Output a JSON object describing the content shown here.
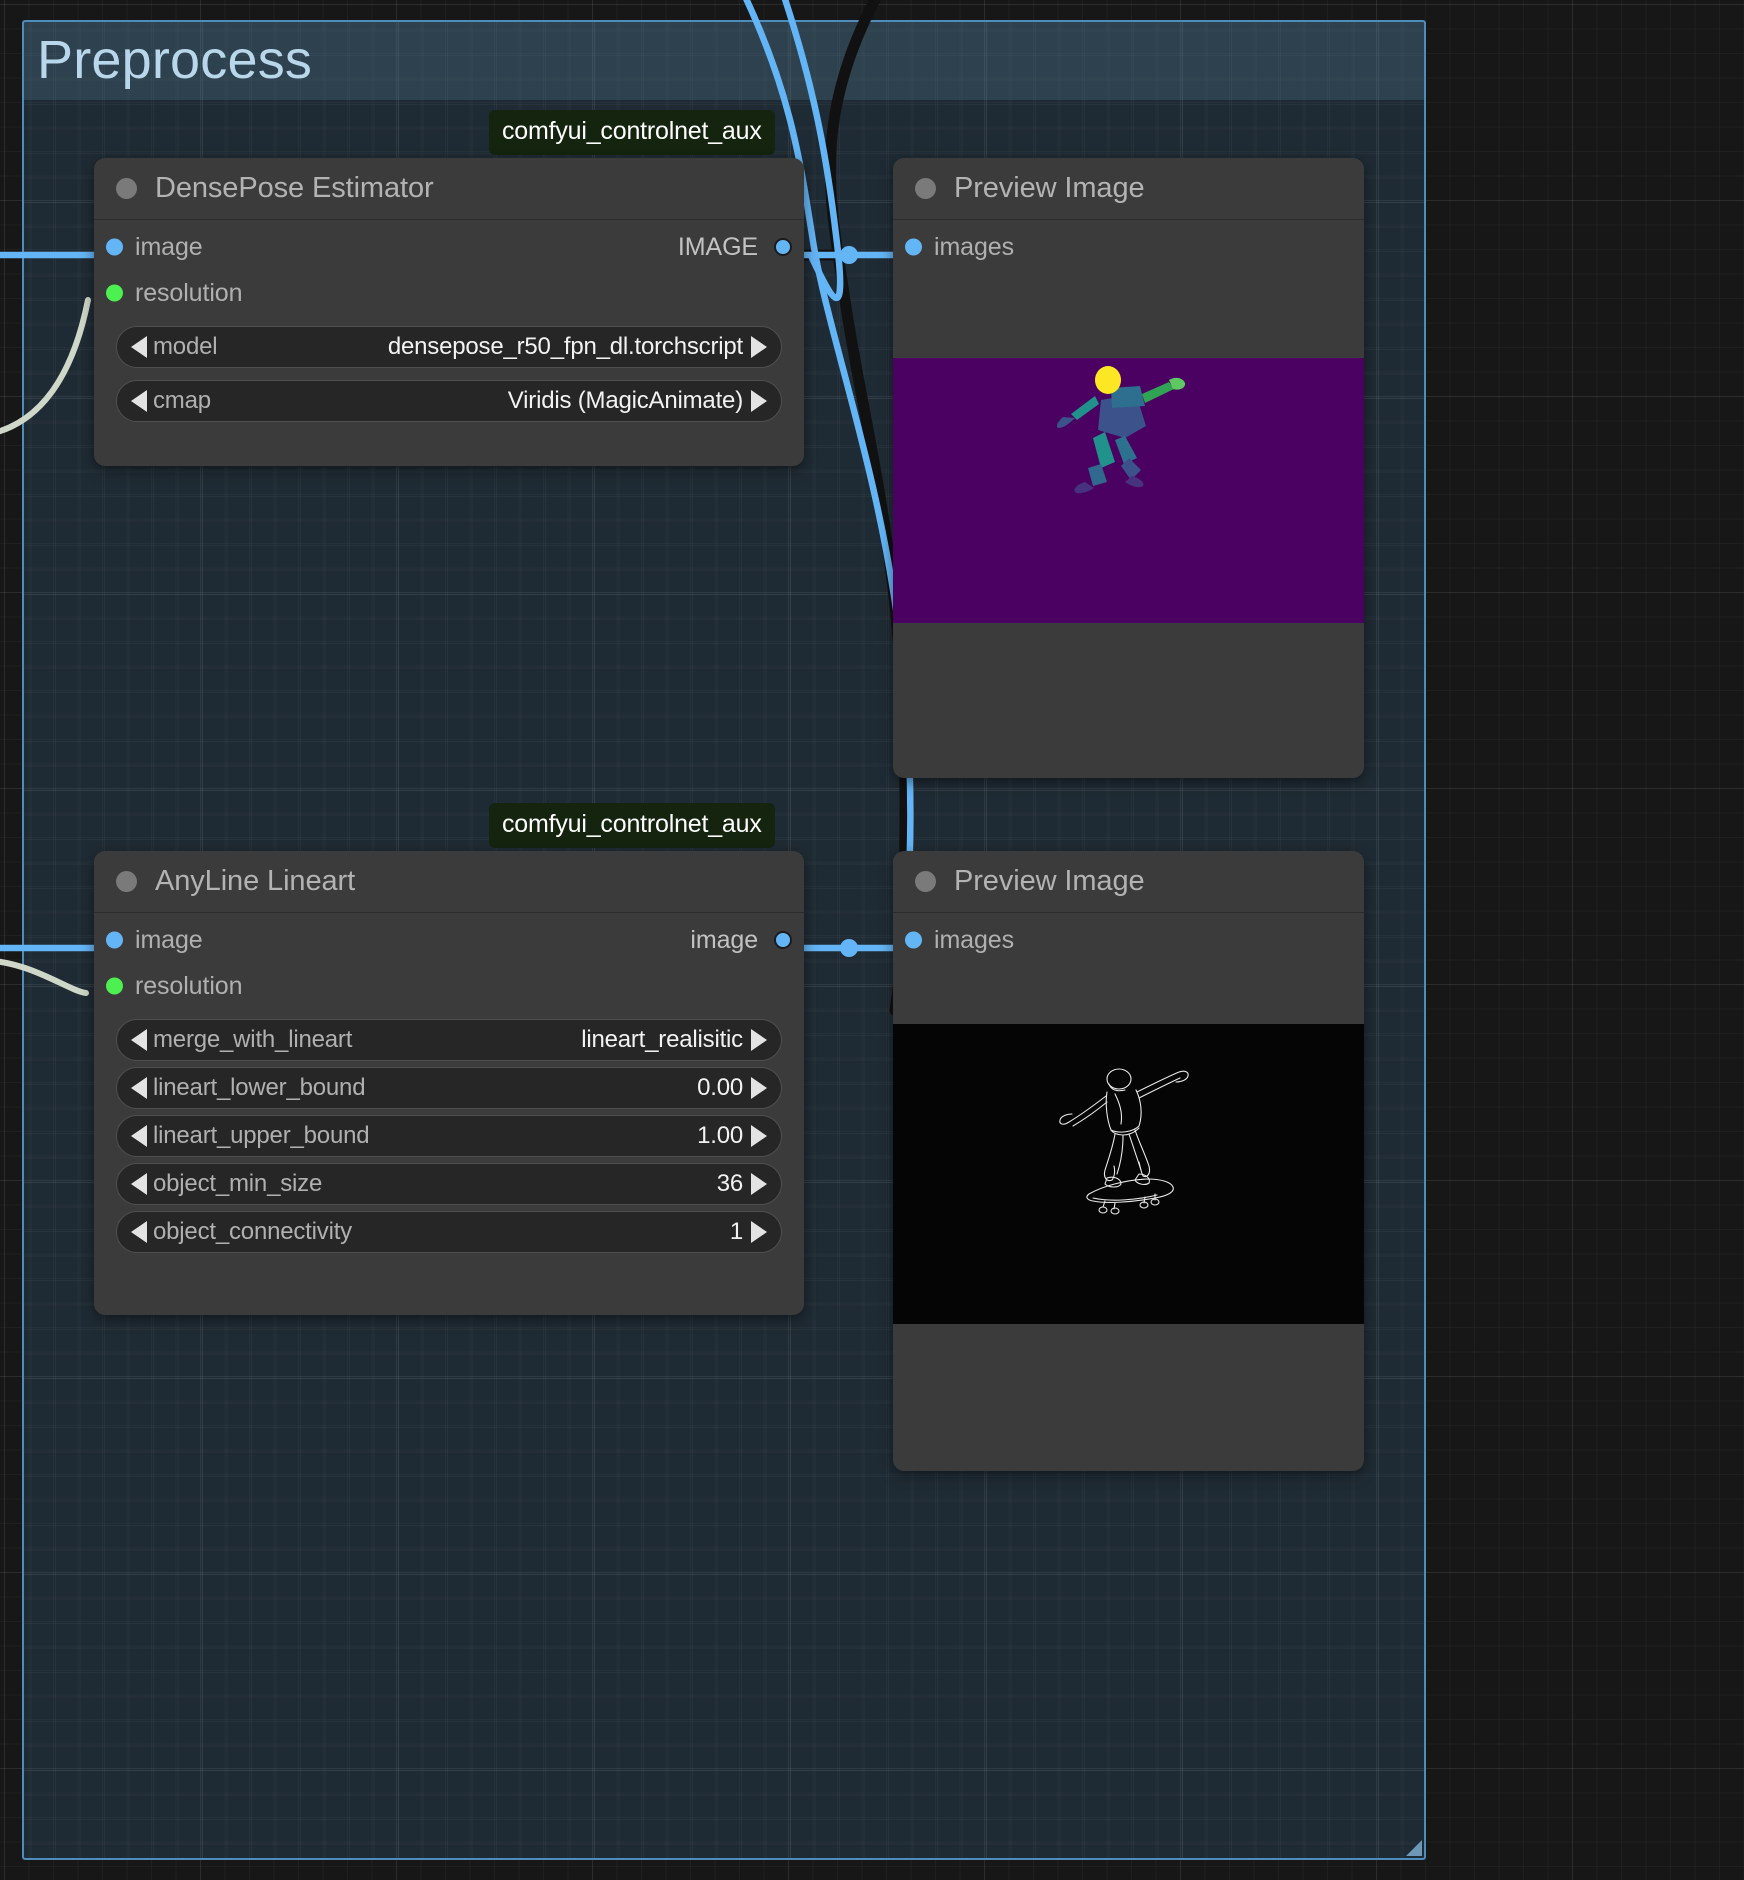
{
  "app": {
    "kind": "node-graph-editor",
    "background_color": "#171717"
  },
  "group": {
    "title": "Preprocess",
    "border_color": "#4e8cba",
    "fill_color": "#3c6e91"
  },
  "badges": [
    {
      "label": "comfyui_controlnet_aux",
      "background": "#14240f",
      "text_color": "#ffffff"
    },
    {
      "label": "comfyui_controlnet_aux",
      "background": "#14240f",
      "text_color": "#ffffff"
    }
  ],
  "nodes": [
    {
      "id": "densepose-estimator",
      "title": "DensePose Estimator",
      "inputs": [
        {
          "name": "image",
          "type": "IMAGE",
          "color": "#64b5f6"
        },
        {
          "name": "resolution",
          "type": "INT",
          "color": "#4cf050"
        }
      ],
      "outputs": [
        {
          "name": "IMAGE",
          "type": "IMAGE",
          "color": "#64b5f6"
        }
      ],
      "widgets": [
        {
          "name": "model",
          "value": "densepose_r50_fpn_dl.torchscript",
          "kind": "combo"
        },
        {
          "name": "cmap",
          "value": "Viridis (MagicAnimate)",
          "kind": "combo"
        }
      ]
    },
    {
      "id": "preview-image-top",
      "title": "Preview Image",
      "inputs": [
        {
          "name": "images",
          "type": "IMAGE",
          "color": "#64b5f6"
        }
      ],
      "outputs": [],
      "widgets": [],
      "preview": {
        "kind": "densepose-render",
        "background": "#4b0161",
        "subject": "person-skateboarding",
        "palette": [
          "#fde725",
          "#5ec962",
          "#21918c",
          "#3b528b",
          "#440154"
        ]
      }
    },
    {
      "id": "anyline-lineart",
      "title": "AnyLine Lineart",
      "inputs": [
        {
          "name": "image",
          "type": "IMAGE",
          "color": "#64b5f6"
        },
        {
          "name": "resolution",
          "type": "INT",
          "color": "#4cf050"
        }
      ],
      "outputs": [
        {
          "name": "image",
          "type": "IMAGE",
          "color": "#64b5f6"
        }
      ],
      "widgets": [
        {
          "name": "merge_with_lineart",
          "value": "lineart_realisitic",
          "kind": "combo"
        },
        {
          "name": "lineart_lower_bound",
          "value": "0.00",
          "kind": "number"
        },
        {
          "name": "lineart_upper_bound",
          "value": "1.00",
          "kind": "number"
        },
        {
          "name": "object_min_size",
          "value": "36",
          "kind": "number"
        },
        {
          "name": "object_connectivity",
          "value": "1",
          "kind": "number"
        }
      ]
    },
    {
      "id": "preview-image-bottom",
      "title": "Preview Image",
      "inputs": [
        {
          "name": "images",
          "type": "IMAGE",
          "color": "#64b5f6"
        }
      ],
      "outputs": [],
      "widgets": [],
      "preview": {
        "kind": "lineart-render",
        "background": "#050505",
        "subject": "person-skateboarding",
        "line_color": "#ffffff"
      }
    }
  ],
  "links": {
    "color": "#64b5f6",
    "reroute_color": "#64b5f6",
    "count": 4
  }
}
